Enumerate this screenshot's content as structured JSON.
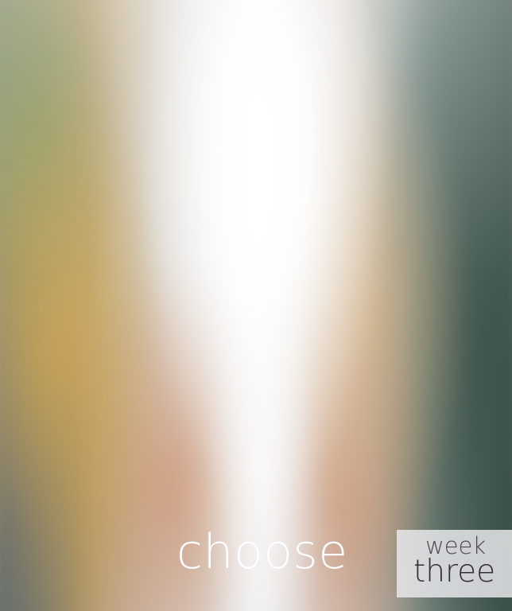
{
  "headline": {
    "text": "choose"
  },
  "badge": {
    "top_text": "week",
    "bottom_text": "three"
  }
}
